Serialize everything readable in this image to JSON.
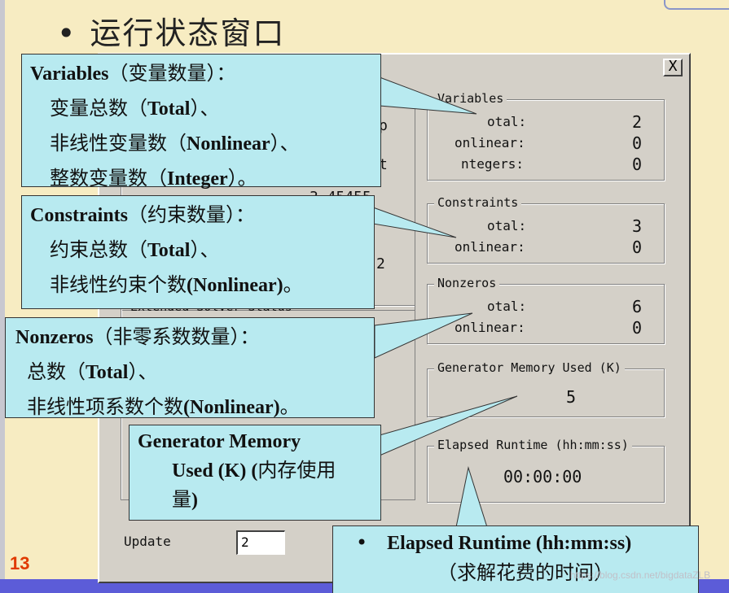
{
  "slide": {
    "bullet": "•",
    "title": "运行状态窗口",
    "page_number": "13",
    "watermark": "https://blog.csdn.net/bigdataZLB"
  },
  "dialog": {
    "close_glyph": "X",
    "variables": {
      "title": "Variables",
      "rows": [
        {
          "label": "otal:",
          "value": "2"
        },
        {
          "label": "onlinear:",
          "value": "0"
        },
        {
          "label": "ntegers:",
          "value": "0"
        }
      ]
    },
    "constraints": {
      "title": "Constraints",
      "rows": [
        {
          "label": "otal:",
          "value": "3"
        },
        {
          "label": "onlinear:",
          "value": "0"
        }
      ]
    },
    "nonzeros": {
      "title": "Nonzeros",
      "rows": [
        {
          "label": "otal:",
          "value": "6"
        },
        {
          "label": "onlinear:",
          "value": "0"
        }
      ]
    },
    "memory": {
      "title": "Generator Memory Used (K)",
      "value": "5"
    },
    "runtime": {
      "title": "Elapsed Runtime (hh:mm:ss)",
      "value": "00:00:00"
    },
    "left_fragments": {
      "f1": "p",
      "f2": "t",
      "f3": "3.45455",
      "f4": "2",
      "f5": "Extended Solver Status"
    },
    "update": {
      "label": "Update",
      "value": "2"
    }
  },
  "callouts": {
    "variables": {
      "line1_en": "Variables",
      "line1_cn": "（变量数量）：",
      "line2_a": "变量总数（",
      "line2_en": "Total",
      "line2_b": "）、",
      "line3_a": "非线性变量数（",
      "line3_en": "Nonlinear",
      "line3_b": "）、",
      "line4_a": "整数变量数（",
      "line4_en": "Integer",
      "line4_b": "）。"
    },
    "constraints": {
      "line1_en": "Constraints",
      "line1_cn": "（约束数量）：",
      "line2_a": "约束总数（",
      "line2_en": "Total",
      "line2_b": "）、",
      "line3_a": "非线性约束个数",
      "line3_en": "(Nonlinear)",
      "line3_b": "。"
    },
    "nonzeros": {
      "line1_en": "Nonzeros",
      "line1_cn": "（非零系数数量）：",
      "line2_a": "总数（",
      "line2_en": "Total",
      "line2_b": "）、",
      "line3_a": "非线性项系数个数",
      "line3_en": "(Nonlinear)",
      "line3_b": "。"
    },
    "memory": {
      "line1_en": "Generator Memory",
      "line2_en": "Used (K) (",
      "line2_cn": "内存使用",
      "line3_cn": "量",
      "line3_en": ")"
    },
    "runtime": {
      "bullet": "•",
      "line1_en": "Elapsed Runtime (hh:mm:ss)",
      "line2_cn": "（求解花费的时间）"
    }
  }
}
